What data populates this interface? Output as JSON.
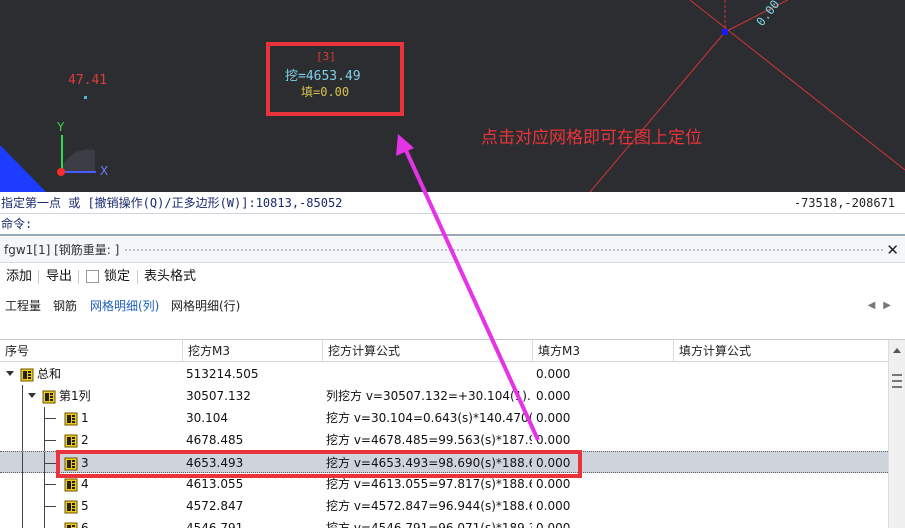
{
  "viewport": {
    "cell_index": "[3]",
    "cut_line": "挖=4653.49",
    "fill_line": "填=0.00",
    "elev_label": "47.41",
    "corner_label": "0.00",
    "axis_y": "Y",
    "axis_x": "X",
    "annotation": "点击对应网格即可在图上定位",
    "colors": {
      "background": "#2b2d31",
      "grid_line": "#d0343a",
      "annotation": "#e8343a",
      "arrow": "#e533e6"
    }
  },
  "command": {
    "line": "指定第一点 或 [撤销操作(Q)/正多边形(W)]:10813,-85052",
    "coords": "-73518,-208671",
    "prompt": "命令:"
  },
  "panel": {
    "title": "fgw1[1] [钢筋重量: ]",
    "toolbar": {
      "add": "添加",
      "export": "导出",
      "lock": "锁定",
      "header_format": "表头格式"
    },
    "tabs": [
      {
        "label": "工程量",
        "active": false
      },
      {
        "label": "钢筋",
        "active": false
      },
      {
        "label": "网格明细(列)",
        "active": true
      },
      {
        "label": "网格明细(行)",
        "active": false
      }
    ]
  },
  "grid": {
    "columns": [
      "序号",
      "挖方M3",
      "挖方计算公式",
      "填方M3",
      "填方计算公式"
    ],
    "rows": [
      {
        "name": "总和",
        "level": 0,
        "cut": "513214.505",
        "formula": "",
        "fill": "0.000",
        "fill_formula": ""
      },
      {
        "name": "第1列",
        "level": 1,
        "cut": "30507.132",
        "formula": "列挖方 v=30507.132=+30.104(1)...",
        "fill": "0.000",
        "fill_formula": ""
      },
      {
        "name": "1",
        "level": 2,
        "cut": "30.104",
        "formula": "挖方 v=30.104=0.643(s)*140.470(...",
        "fill": "0.000",
        "fill_formula": ""
      },
      {
        "name": "2",
        "level": 2,
        "cut": "4678.485",
        "formula": "挖方 v=4678.485=99.563(s)*187.9...",
        "fill": "0.000",
        "fill_formula": ""
      },
      {
        "name": "3",
        "level": 2,
        "cut": "4653.493",
        "formula": "挖方 v=4653.493=98.690(s)*188.6...",
        "fill": "0.000",
        "fill_formula": "",
        "selected": true
      },
      {
        "name": "4",
        "level": 2,
        "cut": "4613.055",
        "formula": "挖方 v=4613.055=97.817(s)*188.6...",
        "fill": "0.000",
        "fill_formula": ""
      },
      {
        "name": "5",
        "level": 2,
        "cut": "4572.847",
        "formula": "挖方 v=4572.847=96.944(s)*188.6...",
        "fill": "0.000",
        "fill_formula": ""
      },
      {
        "name": "6",
        "level": 2,
        "cut": "4546.791",
        "formula": "挖方 v=4546.791=96.071(s)*189.3...",
        "fill": "0.000",
        "fill_formula": ""
      }
    ]
  }
}
